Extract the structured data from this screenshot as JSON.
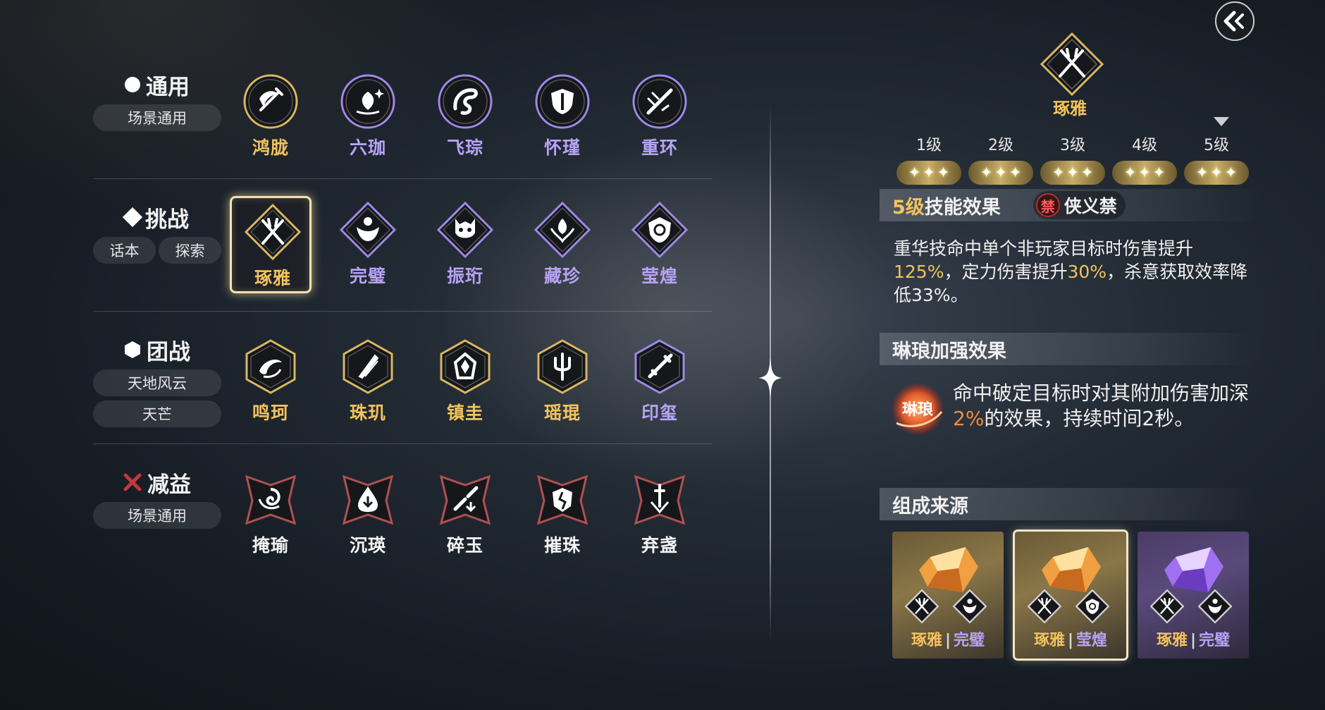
{
  "categories": [
    {
      "title": "通用",
      "symbol": "circle",
      "tags": [
        "场景通用"
      ],
      "skills": [
        {
          "name": "鸿胧",
          "color": "gold",
          "icon": "sword-wave-icon"
        },
        {
          "name": "六珈",
          "color": "purple",
          "icon": "lotus-sparkle-icon"
        },
        {
          "name": "飞琮",
          "color": "purple",
          "icon": "dragon-icon"
        },
        {
          "name": "怀瑾",
          "color": "purple",
          "icon": "shield-burst-icon"
        },
        {
          "name": "重环",
          "color": "purple",
          "icon": "sword-slash-icon"
        }
      ]
    },
    {
      "title": "挑战",
      "symbol": "diamond",
      "tags": [
        "话本",
        "探索"
      ],
      "skills": [
        {
          "name": "琢雅",
          "color": "gold",
          "icon": "crossed-swords-icon",
          "selected": true
        },
        {
          "name": "完璧",
          "color": "purple",
          "icon": "warrior-icon"
        },
        {
          "name": "振珩",
          "color": "purple",
          "icon": "demon-mask-icon"
        },
        {
          "name": "藏珍",
          "color": "purple",
          "icon": "phoenix-icon"
        },
        {
          "name": "莹煌",
          "color": "purple",
          "icon": "shield-spiral-icon"
        }
      ]
    },
    {
      "title": "团战",
      "symbol": "hexagon",
      "tags": [
        "天地风云",
        "天芒"
      ],
      "skills": [
        {
          "name": "鸣珂",
          "color": "gold",
          "icon": "wind-swirl-icon"
        },
        {
          "name": "珠玑",
          "color": "gold",
          "icon": "feather-blades-icon"
        },
        {
          "name": "镇圭",
          "color": "gold",
          "icon": "armor-icon"
        },
        {
          "name": "瑶琨",
          "color": "gold",
          "icon": "trident-icon"
        },
        {
          "name": "印玺",
          "color": "purple",
          "icon": "dagger-icon"
        }
      ]
    },
    {
      "title": "减益",
      "symbol": "cross",
      "tags": [
        "场景通用"
      ],
      "skills": [
        {
          "name": "掩瑜",
          "color": "white",
          "icon": "vortex-icon"
        },
        {
          "name": "沉瑛",
          "color": "white",
          "icon": "drop-down-icon"
        },
        {
          "name": "碎玉",
          "color": "white",
          "icon": "broken-blade-icon"
        },
        {
          "name": "摧珠",
          "color": "white",
          "icon": "broken-helm-icon"
        },
        {
          "name": "弃盏",
          "color": "white",
          "icon": "falling-sword-icon"
        }
      ]
    }
  ],
  "detail": {
    "name": "琢雅",
    "levels": [
      "1级",
      "2级",
      "3级",
      "4级",
      "5级"
    ],
    "current_level_index": 4,
    "stars_per_level": 3,
    "effect_level": "5级",
    "effect_title": "技能效果",
    "ban_icon": "禁",
    "ban_text": "侠义禁",
    "effect_desc": {
      "p1": "重华技命中单个非玩家目标时伤害提升",
      "v1": "125%",
      "p2": "，定力伤害提升",
      "v2": "30%",
      "p3": "，杀意获取效率降低33%。"
    },
    "linlang_title": "琳琅加强效果",
    "linlang_emblem": "琳琅",
    "linlang_desc": {
      "p1": "命中破定目标时对其附加伤害加深",
      "v1": "2%",
      "p2": "的效果，持续时间2秒。"
    },
    "source_title": "组成来源",
    "sources": [
      {
        "gem": "gold",
        "a": "琢雅",
        "b": "完璧",
        "b_color": "purple"
      },
      {
        "gem": "gold",
        "a": "琢雅",
        "b": "莹煌",
        "b_color": "purple",
        "selected": true
      },
      {
        "gem": "purple",
        "a": "琢雅",
        "b": "完璧",
        "b_color": "purple"
      }
    ]
  },
  "colors": {
    "gold": "#f2c35c",
    "purple": "#b7a3f4",
    "orange": "#f28a3c"
  }
}
